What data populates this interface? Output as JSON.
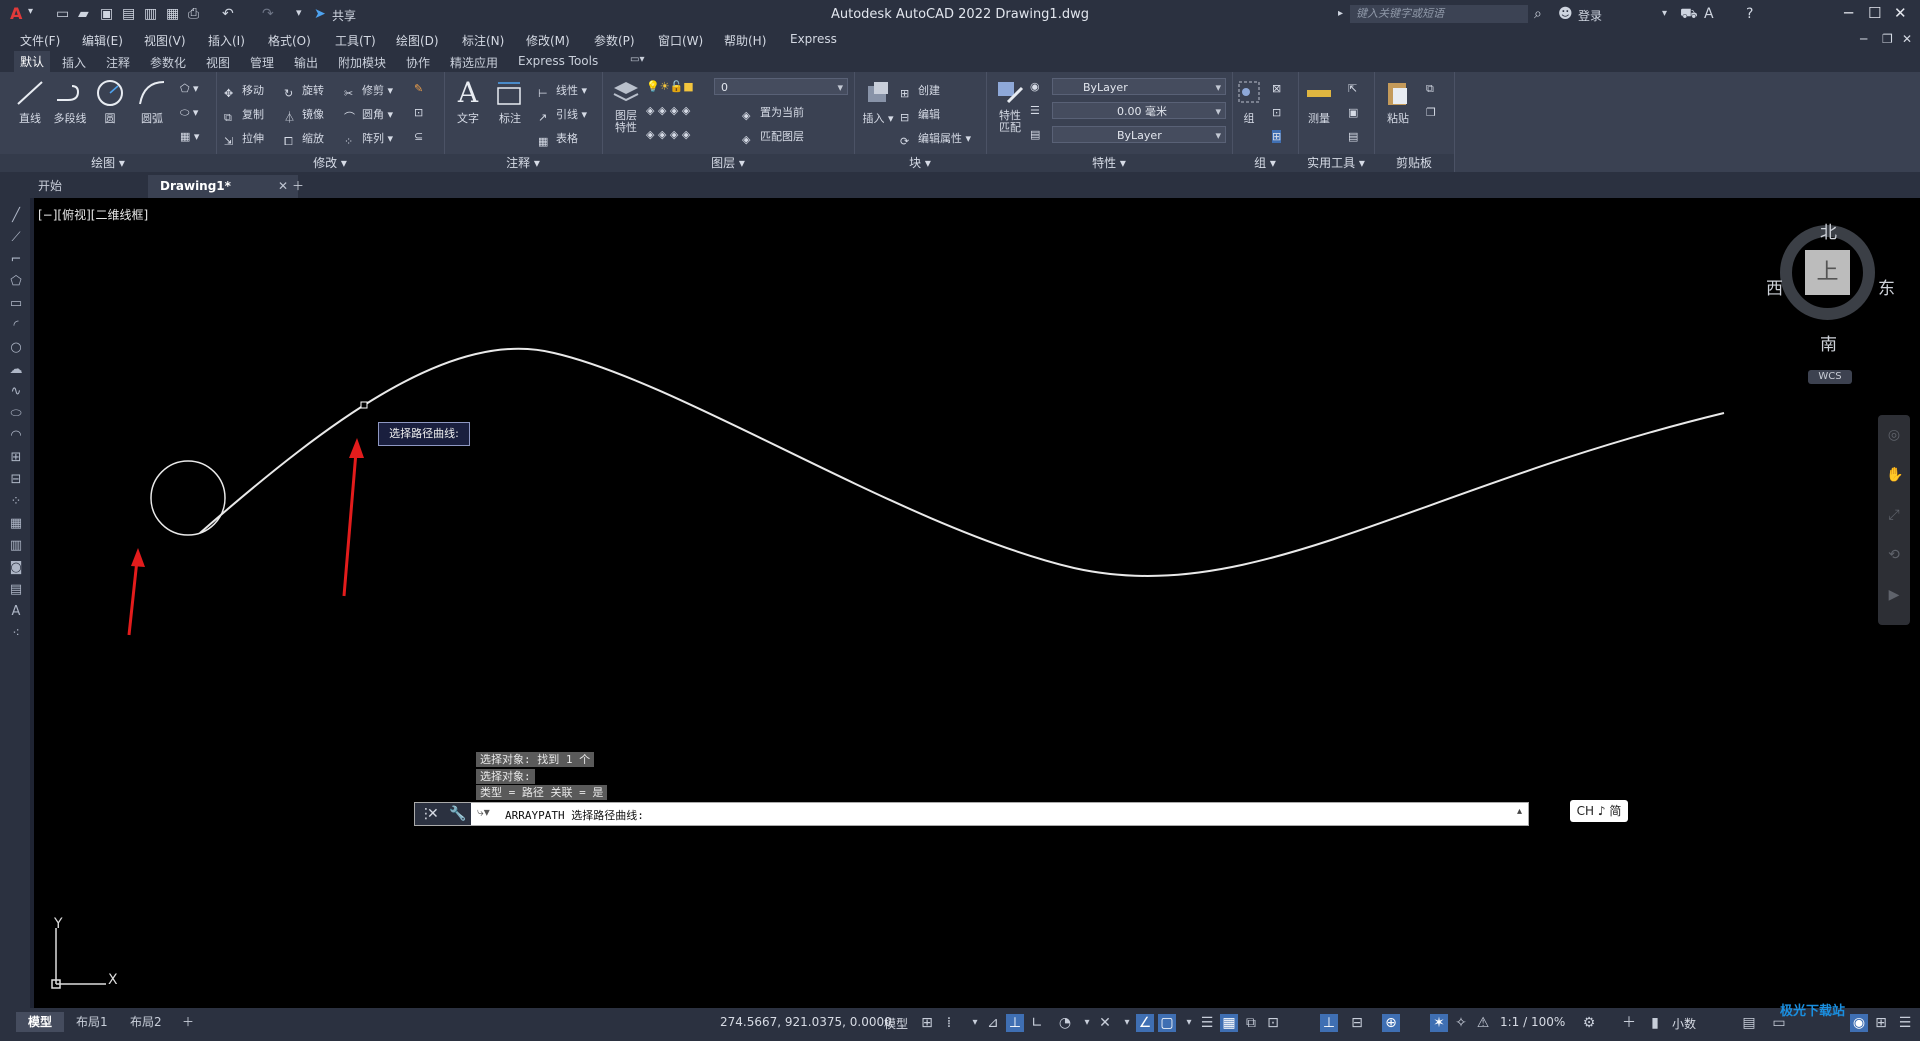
{
  "app": {
    "title": "Autodesk AutoCAD 2022    Drawing1.dwg",
    "logo": "A",
    "share_label": "共享",
    "search_placeholder": "键入关键字或短语",
    "login_label": "登录"
  },
  "menubar": [
    "文件(F)",
    "编辑(E)",
    "视图(V)",
    "插入(I)",
    "格式(O)",
    "工具(T)",
    "绘图(D)",
    "标注(N)",
    "修改(M)",
    "参数(P)",
    "窗口(W)",
    "帮助(H)",
    "Express"
  ],
  "ribbon_tabs": [
    "默认",
    "插入",
    "注释",
    "参数化",
    "视图",
    "管理",
    "输出",
    "附加模块",
    "协作",
    "精选应用",
    "Express Tools"
  ],
  "ribbon": {
    "draw": {
      "title": "绘图",
      "line": "直线",
      "polyline": "多段线",
      "circle": "圆",
      "arc": "圆弧"
    },
    "modify": {
      "title": "修改",
      "move": "移动",
      "rotate": "旋转",
      "trim": "修剪",
      "copy": "复制",
      "mirror": "镜像",
      "fillet": "圆角",
      "stretch": "拉伸",
      "scale": "缩放",
      "array": "阵列"
    },
    "annotation": {
      "title": "注释",
      "text": "文字",
      "dimension": "标注",
      "linear": "线性",
      "leader": "引线",
      "table": "表格"
    },
    "layers": {
      "title": "图层",
      "layer_props": "图层\n特性",
      "layer_value": "0",
      "set_current": "置为当前",
      "match_layer": "匹配图层"
    },
    "block": {
      "title": "块",
      "insert": "插入",
      "create": "创建",
      "edit": "编辑",
      "edit_attr": "编辑属性"
    },
    "properties": {
      "title": "特性",
      "match": "特性\n匹配",
      "color": "ByLayer",
      "lineweight": "0.00 毫米",
      "linetype": "ByLayer"
    },
    "groups": {
      "title": "组",
      "group": "组"
    },
    "utilities": {
      "title": "实用工具",
      "measure": "测量"
    },
    "clipboard": {
      "title": "剪贴板",
      "paste": "粘贴"
    }
  },
  "file_tabs": {
    "start": "开始",
    "drawing": "Drawing1*"
  },
  "viewport": {
    "label": "[−][俯视][二维线框]",
    "tooltip": "选择路径曲线:",
    "compass": {
      "north": "北",
      "south": "南",
      "east": "东",
      "west": "西",
      "face": "上"
    },
    "wcs": "WCS",
    "ucs_x": "X",
    "ucs_y": "Y"
  },
  "command": {
    "history": [
      "选择对象: 找到 1 个",
      "选择对象:",
      "类型 = 路径  关联 = 是"
    ],
    "current": "ARRAYPATH 选择路径曲线:"
  },
  "ime": "CH ♪ 简",
  "status": {
    "layout_tabs": [
      "模型",
      "布局1",
      "布局2"
    ],
    "coords": "274.5667, 921.0375, 0.0000",
    "model": "模型",
    "scale": "1:1 / 100%",
    "units": "小数"
  },
  "watermark": "极光下载站"
}
